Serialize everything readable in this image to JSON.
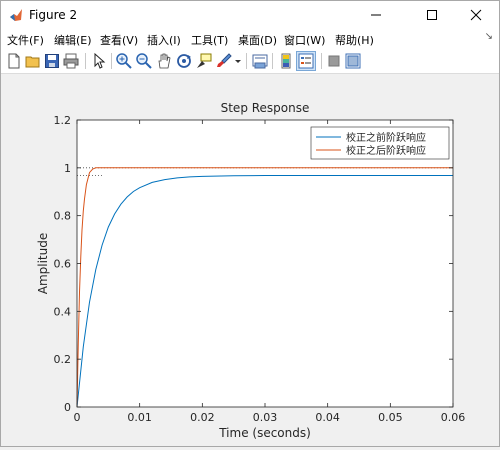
{
  "window": {
    "title": "Figure 2"
  },
  "menu": {
    "items": [
      "文件(F)",
      "编辑(E)",
      "查看(V)",
      "插入(I)",
      "工具(T)",
      "桌面(D)",
      "窗口(W)",
      "帮助(H)"
    ]
  },
  "toolbar": {
    "icons": [
      "new-figure-icon",
      "open-file-icon",
      "save-icon",
      "print-icon",
      "pointer-icon",
      "zoom-in-icon",
      "zoom-out-icon",
      "pan-icon",
      "rotate-3d-icon",
      "data-cursor-icon",
      "brush-icon",
      "brush-dropdown-icon",
      "link-plot-icon",
      "colorbar-icon",
      "legend-icon",
      "hide-plot-tools-icon",
      "show-plot-tools-icon"
    ]
  },
  "chart_data": {
    "type": "line",
    "title": "Step Response",
    "xlabel": "Time (seconds)",
    "ylabel": "Amplitude",
    "xlim": [
      0,
      0.06
    ],
    "ylim": [
      0,
      1.2
    ],
    "xticks": [
      "0",
      "0.01",
      "0.02",
      "0.03",
      "0.04",
      "0.05",
      "0.06"
    ],
    "yticks": [
      "0",
      "0.2",
      "0.4",
      "0.6",
      "0.8",
      "1",
      "1.2"
    ],
    "xtick_values": [
      0,
      0.01,
      0.02,
      0.03,
      0.04,
      0.05,
      0.06
    ],
    "ytick_values": [
      0,
      0.2,
      0.4,
      0.6,
      0.8,
      1.0,
      1.2
    ],
    "grid": false,
    "legend_position": "top-right",
    "series": [
      {
        "name": "校正之前阶跃响应",
        "color": "#0072bd",
        "x": [
          0,
          0.001,
          0.002,
          0.003,
          0.004,
          0.005,
          0.006,
          0.007,
          0.008,
          0.009,
          0.01,
          0.012,
          0.014,
          0.016,
          0.018,
          0.02,
          0.025,
          0.03,
          0.035,
          0.04,
          0.045,
          0.05,
          0.055,
          0.06
        ],
        "y": [
          0,
          0.252,
          0.438,
          0.575,
          0.677,
          0.752,
          0.807,
          0.848,
          0.878,
          0.901,
          0.917,
          0.939,
          0.951,
          0.958,
          0.962,
          0.964,
          0.967,
          0.968,
          0.968,
          0.968,
          0.968,
          0.968,
          0.968,
          0.968
        ]
      },
      {
        "name": "校正之后阶跃响应",
        "color": "#d95319",
        "x": [
          0,
          0.0002,
          0.0004,
          0.0006,
          0.0008,
          0.001,
          0.0012,
          0.0015,
          0.002,
          0.0025,
          0.003,
          0.004,
          0.006,
          0.01,
          0.02,
          0.03,
          0.04,
          0.05,
          0.06
        ],
        "y": [
          0,
          0.27,
          0.48,
          0.63,
          0.74,
          0.82,
          0.87,
          0.93,
          0.98,
          0.995,
          1.0,
          1.0,
          1.0,
          1.0,
          1.0,
          1.0,
          1.0,
          1.0,
          1.0
        ]
      }
    ],
    "reference_lines": [
      {
        "y": 0.968,
        "style": "dotted",
        "x_to": 0.004
      },
      {
        "y": 1.0,
        "style": "dotted",
        "x_to": 0.06
      }
    ]
  },
  "colors": {
    "axis_text": "#262626",
    "axes_bg": "#ffffff",
    "figure_bg": "#f0f0f0"
  }
}
